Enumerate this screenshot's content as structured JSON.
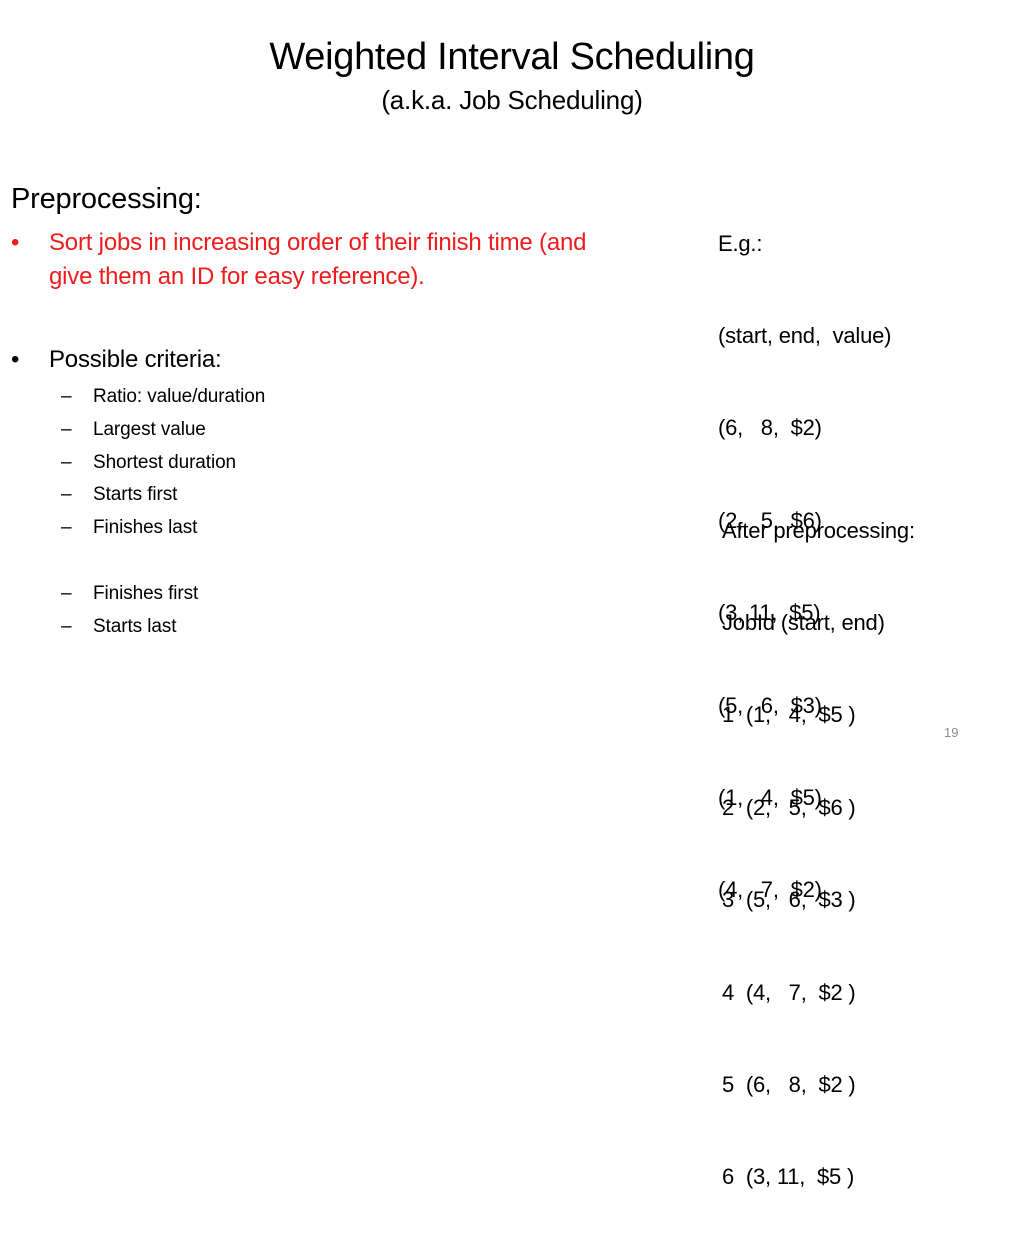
{
  "slide": {
    "title": "Weighted Interval Scheduling",
    "subtitle": "(a.k.a. Job Scheduling)",
    "page_number": "19"
  },
  "left": {
    "heading": "Preprocessing:",
    "bullets": [
      {
        "marker": "•",
        "lines": [
          "Sort jobs in increasing order of their finish time (and",
          "give them an ID for easy reference)."
        ],
        "color": "#ee1c1c"
      },
      {
        "marker": "•",
        "lines": [
          "Possible criteria:"
        ],
        "color": "#000000"
      }
    ],
    "criteria": [
      {
        "marker": "–",
        "label": "Ratio: value/duration"
      },
      {
        "marker": "–",
        "label": "Largest value"
      },
      {
        "marker": "–",
        "label": "Shortest duration"
      },
      {
        "marker": "–",
        "label": "Starts first"
      },
      {
        "marker": "–",
        "label": "Finishes last"
      },
      {
        "marker": "–",
        "label": "Finishes first"
      },
      {
        "marker": "–",
        "label": "Starts last"
      }
    ]
  },
  "example": {
    "heading": "E.g.:",
    "columns": "(start, end,  value)",
    "rows": [
      "(6,   8,  $2)",
      "(2,   5,  $6)",
      "(3, 11,  $5)",
      "(5,   6,  $3)",
      "(1,   4,  $5)",
      "(4,   7,  $2)"
    ],
    "jobs": [
      {
        "start": 6,
        "end": 8,
        "value": "$2"
      },
      {
        "start": 2,
        "end": 5,
        "value": "$6"
      },
      {
        "start": 3,
        "end": 11,
        "value": "$5"
      },
      {
        "start": 5,
        "end": 6,
        "value": "$3"
      },
      {
        "start": 1,
        "end": 4,
        "value": "$5"
      },
      {
        "start": 4,
        "end": 7,
        "value": "$2"
      }
    ]
  },
  "after_preprocessing": {
    "heading": "After preprocessing:",
    "columns": "JobId (start, end)",
    "rows": [
      "1  (1,   4,  $5 )",
      "2  (2,   5,  $6 )",
      "3  (5,   6,  $3 )",
      "4  (4,   7,  $2 )",
      "5  (6,   8,  $2 )",
      "6  (3, 11,  $5 )"
    ],
    "jobs": [
      {
        "id": 1,
        "start": 1,
        "end": 4,
        "value": "$5"
      },
      {
        "id": 2,
        "start": 2,
        "end": 5,
        "value": "$6"
      },
      {
        "id": 3,
        "start": 5,
        "end": 6,
        "value": "$3"
      },
      {
        "id": 4,
        "start": 4,
        "end": 7,
        "value": "$2"
      },
      {
        "id": 5,
        "start": 6,
        "end": 8,
        "value": "$2"
      },
      {
        "id": 6,
        "start": 3,
        "end": 11,
        "value": "$5"
      }
    ]
  }
}
